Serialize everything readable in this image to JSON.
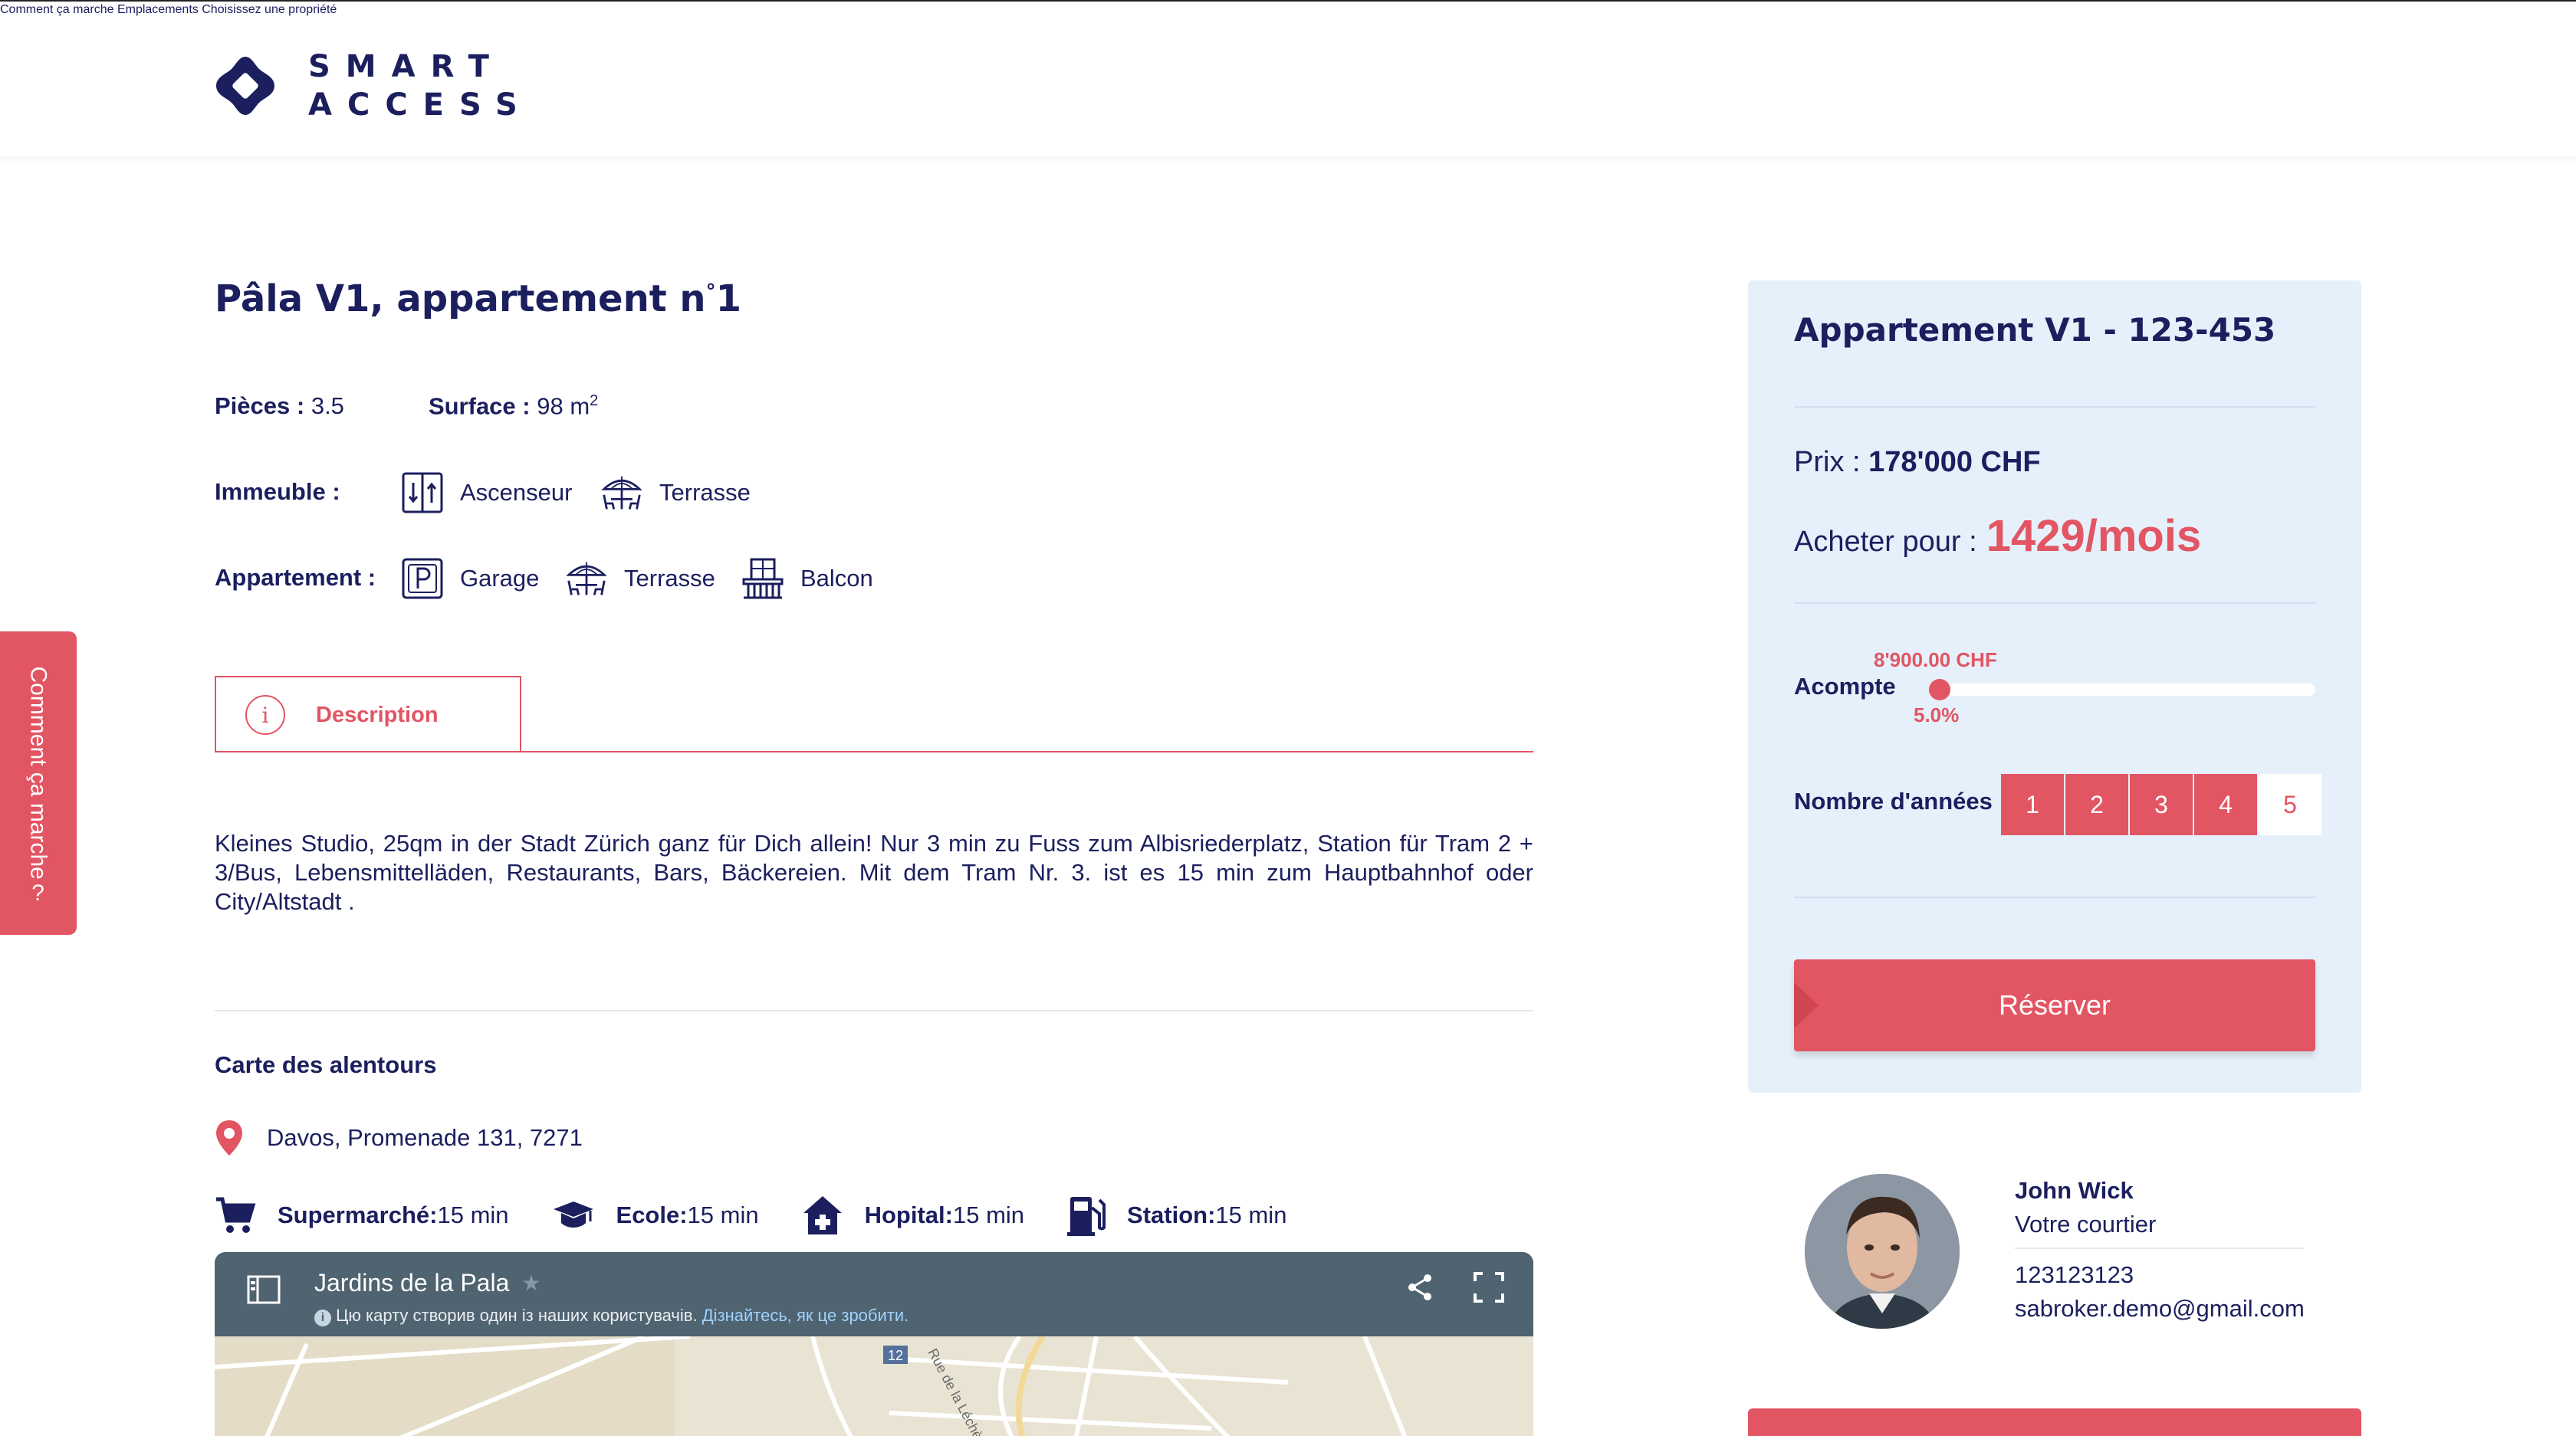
{
  "header": {
    "logo_line1": "SMART",
    "logo_line2": "ACCESS",
    "nav": [
      "Comment ça marche",
      "Emplacements",
      "Choisissez une propriété"
    ]
  },
  "side_tab": {
    "label": "Comment ça marche",
    "icon": "question-icon"
  },
  "property": {
    "title_main": "Pâla V1, appartement n",
    "title_sup": "°",
    "title_end": "1",
    "rooms_label": "Pièces :",
    "rooms_value": "3.5",
    "surface_label": "Surface :",
    "surface_value": "98 m",
    "surface_sup": "2",
    "building_label": "Immeuble :",
    "building_features": [
      "Ascenseur",
      "Terrasse"
    ],
    "apartment_label": "Appartement :",
    "apartment_features": [
      "Garage",
      "Terrasse",
      "Balcon"
    ],
    "tab_label": "Description",
    "description": "Kleines Studio, 25qm in der Stadt Zürich ganz für Dich allein! Nur 3 min zu Fuss zum Albisriederplatz, Station für Tram 2 + 3/Bus, Lebensmittelläden, Restaurants, Bars, Bäckereien. Mit dem Tram Nr. 3. ist es 15 min zum Hauptbahnhof oder City/Altstadt ."
  },
  "surroundings": {
    "title": "Carte des alentours",
    "address": "Davos, Promenade 131, 7271",
    "pois": [
      {
        "label": "Supermarché:",
        "value": "15 min",
        "icon": "cart-icon"
      },
      {
        "label": "Ecole:",
        "value": "15 min",
        "icon": "graduation-cap-icon"
      },
      {
        "label": "Hopital:",
        "value": "15 min",
        "icon": "hospital-icon"
      },
      {
        "label": "Station:",
        "value": "15 min",
        "icon": "fuel-station-icon"
      }
    ],
    "map": {
      "name": "Jardins de la Pala",
      "note": "Цю карту створив один із наших користувачів.",
      "note_link": "Дізнайтесь, як це зробити.",
      "road_badge": "12",
      "road_name": "Rue de la Léchère"
    }
  },
  "panel": {
    "title": "Appartement V1 - 123-453",
    "price_label": "Prix :",
    "price_value": "178'000 CHF",
    "buy_label": "Acheter pour :",
    "buy_value": "1429/mois",
    "deposit_label": "Acompte",
    "deposit_amount": "8'900.00 CHF",
    "deposit_percent": "5.0%",
    "deposit_fraction": 0.0,
    "years_label": "Nombre d'années",
    "years": [
      "1",
      "2",
      "3",
      "4",
      "5"
    ],
    "years_selected": "5",
    "reserve_label": "Réserver"
  },
  "broker": {
    "name": "John Wick",
    "role": "Votre courtier",
    "phone": "123123123",
    "email": "sabroker.demo@gmail.com"
  },
  "colors": {
    "accent": "#e25563",
    "navy": "#1b1f5e",
    "panel": "#e6f0fa",
    "map_bar": "#4f6370"
  }
}
